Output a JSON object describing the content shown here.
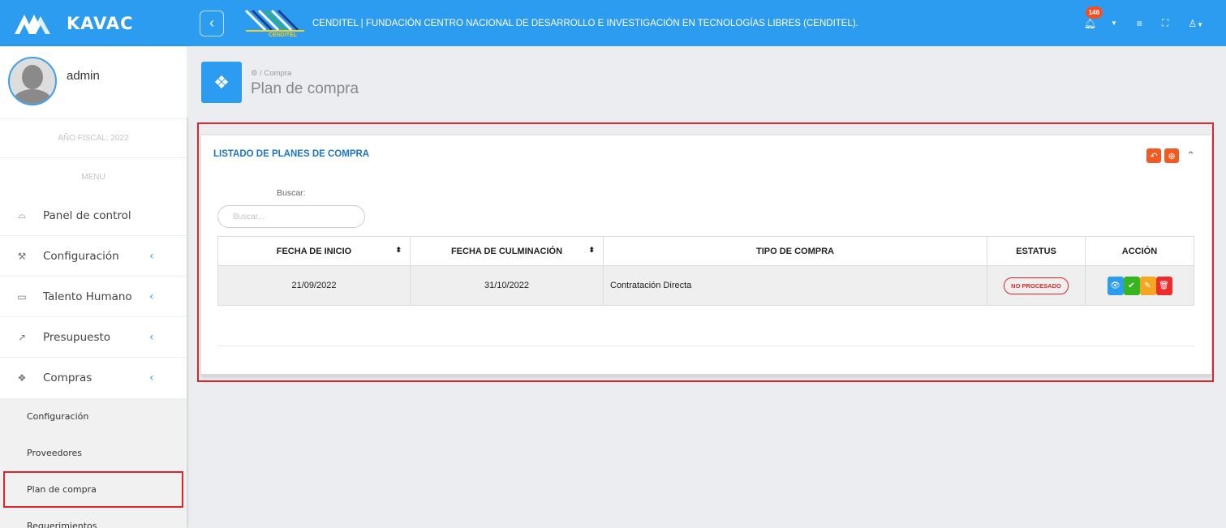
{
  "app": {
    "brand_name": "KAVAC",
    "toggle_icon": "chevron-left-icon"
  },
  "topbar": {
    "logo_caption": "CENDITEL",
    "org_name": "CENDITEL | FUNDACIÓN CENTRO NACIONAL DE DESARROLLO E INVESTIGACIÓN EN TECNOLOGÍAS LIBRES (CENDITEL).",
    "notification_count": "146",
    "accent_color": "#2c9cf0"
  },
  "sidebar": {
    "username": "admin",
    "fiscal_year": "AÑO FISCAL: 2022",
    "menu_title": "MENU",
    "items": [
      {
        "label": "Panel de control",
        "icon": "dashboard-icon",
        "glyph": "⌓",
        "expandable": false
      },
      {
        "label": "Configuración",
        "icon": "tools-icon",
        "glyph": "⚒",
        "expandable": true
      },
      {
        "label": "Talento Humano",
        "icon": "folder-icon",
        "glyph": "▭",
        "expandable": true
      },
      {
        "label": "Presupuesto",
        "icon": "trend-icon",
        "glyph": "↗",
        "expandable": true
      },
      {
        "label": "Compras",
        "icon": "dropbox-icon",
        "glyph": "❖",
        "expandable": true
      }
    ],
    "chevron": "‹",
    "submenu": [
      "Configuración",
      "Proveedores",
      "Plan de compra",
      "Requerimientos"
    ]
  },
  "header": {
    "breadcrumb": "Compra",
    "title": "Plan de compra",
    "icon": "dropbox-icon"
  },
  "card": {
    "title": "LISTADO DE PLANES DE COMPRA",
    "search_label": "Buscar:",
    "search_placeholder": "Buscar...",
    "columns": [
      "FECHA DE INICIO",
      "FECHA DE CULMINACIÓN",
      "TIPO DE COMPRA",
      "ESTATUS",
      "ACCIÓN"
    ],
    "rows": [
      {
        "start": "21/09/2022",
        "end": "31/10/2022",
        "type": "Contratación Directa",
        "status": "NO PROCESADO"
      }
    ],
    "status_color": "#e0262c",
    "action_colors": [
      "#2c9cf0",
      "#35b51f",
      "#f5a623",
      "#ef2c2c"
    ]
  }
}
